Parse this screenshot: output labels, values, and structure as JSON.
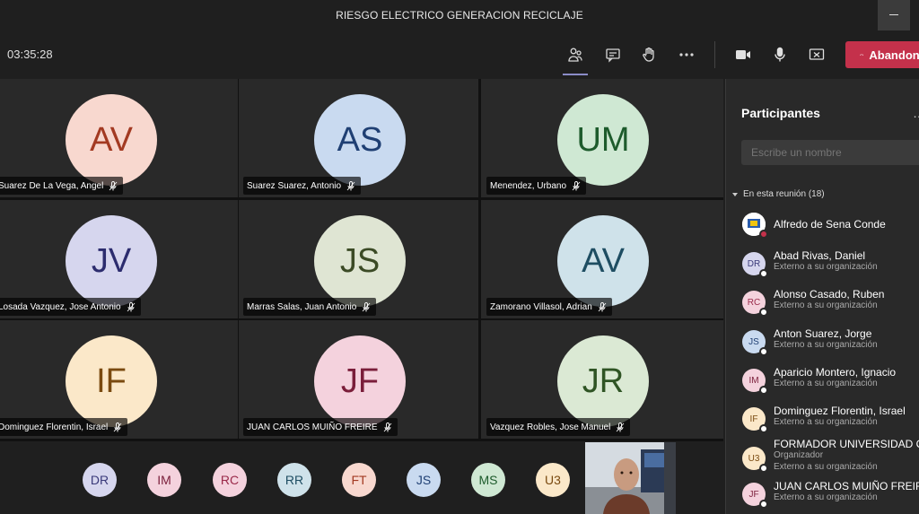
{
  "window": {
    "title": "RIESGO ELECTRICO GENERACION RECICLAJE"
  },
  "toolbar": {
    "timer": "03:35:28",
    "leave_label": "Abandonar",
    "icons": [
      "people-icon",
      "chat-icon",
      "raise-hand-icon",
      "more-icon",
      "camera-icon",
      "mic-icon",
      "share-screen-icon"
    ]
  },
  "tiles": [
    {
      "initials": "AV",
      "name": "Suarez De La Vega, Angel",
      "bg": "#f8d8cf",
      "fg": "#a33a22"
    },
    {
      "initials": "AS",
      "name": "Suarez Suarez, Antonio",
      "bg": "#c9daf0",
      "fg": "#1f3f73"
    },
    {
      "initials": "UM",
      "name": "Menendez, Urbano",
      "bg": "#cfe8d3",
      "fg": "#1d5b2c"
    },
    {
      "initials": "JV",
      "name": "Losada Vazquez, Jose Antonio",
      "bg": "#d6d6ee",
      "fg": "#2c2c6e"
    },
    {
      "initials": "JS",
      "name": "Marras Salas, Juan Antonio",
      "bg": "#dfe5d3",
      "fg": "#3b4a25"
    },
    {
      "initials": "AV",
      "name": "Zamorano Villasol, Adrian",
      "bg": "#cfe2ea",
      "fg": "#1e4d62"
    },
    {
      "initials": "IF",
      "name": "Dominguez Florentin, Israel",
      "bg": "#fbe8c9",
      "fg": "#7a4a10"
    },
    {
      "initials": "JF",
      "name": "JUAN CARLOS MUIÑO FREIRE",
      "bg": "#f4d2dd",
      "fg": "#7a1e3a"
    },
    {
      "initials": "JR",
      "name": "Vazquez Robles, Jose Manuel",
      "bg": "#dbe9d4",
      "fg": "#2f5424"
    }
  ],
  "strip": [
    {
      "initials": "DR",
      "bg": "#d6d6ee",
      "fg": "#3a3a7a"
    },
    {
      "initials": "IM",
      "bg": "#f4d2dd",
      "fg": "#7a1e3a"
    },
    {
      "initials": "RC",
      "bg": "#f4d2dd",
      "fg": "#9a2a4a"
    },
    {
      "initials": "RR",
      "bg": "#cfe2ea",
      "fg": "#1e4d62"
    },
    {
      "initials": "FT",
      "bg": "#f8d8cf",
      "fg": "#a33a22"
    },
    {
      "initials": "JS",
      "bg": "#c9daf0",
      "fg": "#1f3f73"
    },
    {
      "initials": "MS",
      "bg": "#cfe8d3",
      "fg": "#1d5b2c"
    },
    {
      "initials": "U3",
      "bg": "#fbe8c9",
      "fg": "#7a4a10"
    }
  ],
  "panel": {
    "title": "Participantes",
    "search_placeholder": "Escribe un nombre",
    "section_label": "En esta reunión (18)",
    "participants": [
      {
        "initials": "",
        "name": "Alfredo de Sena Conde",
        "sub": "",
        "bg": "#ffffff",
        "fg": "#333333"
      },
      {
        "initials": "DR",
        "name": "Abad Rivas, Daniel",
        "sub": "Externo a su organización",
        "bg": "#d6d6ee",
        "fg": "#3a3a7a"
      },
      {
        "initials": "RC",
        "name": "Alonso Casado, Ruben",
        "sub": "Externo a su organización",
        "bg": "#f4d2dd",
        "fg": "#9a2a4a"
      },
      {
        "initials": "JS",
        "name": "Anton Suarez, Jorge",
        "sub": "Externo a su organización",
        "bg": "#c9daf0",
        "fg": "#1f3f73"
      },
      {
        "initials": "IM",
        "name": "Aparicio Montero, Ignacio",
        "sub": "Externo a su organización",
        "bg": "#f4d2dd",
        "fg": "#7a1e3a"
      },
      {
        "initials": "IF",
        "name": "Dominguez Florentin, Israel",
        "sub": "Externo a su organización",
        "bg": "#fbe8c9",
        "fg": "#7a4a10"
      },
      {
        "initials": "U3",
        "name": "FORMADOR UNIVERSIDAD C...",
        "sub": "Organizador",
        "sub2": "Externo a su organización",
        "bg": "#fbe8c9",
        "fg": "#7a4a10"
      },
      {
        "initials": "JF",
        "name": "JUAN CARLOS MUIÑO FREIRE",
        "sub": "Externo a su organización",
        "bg": "#f4d2dd",
        "fg": "#7a1e3a"
      }
    ]
  }
}
